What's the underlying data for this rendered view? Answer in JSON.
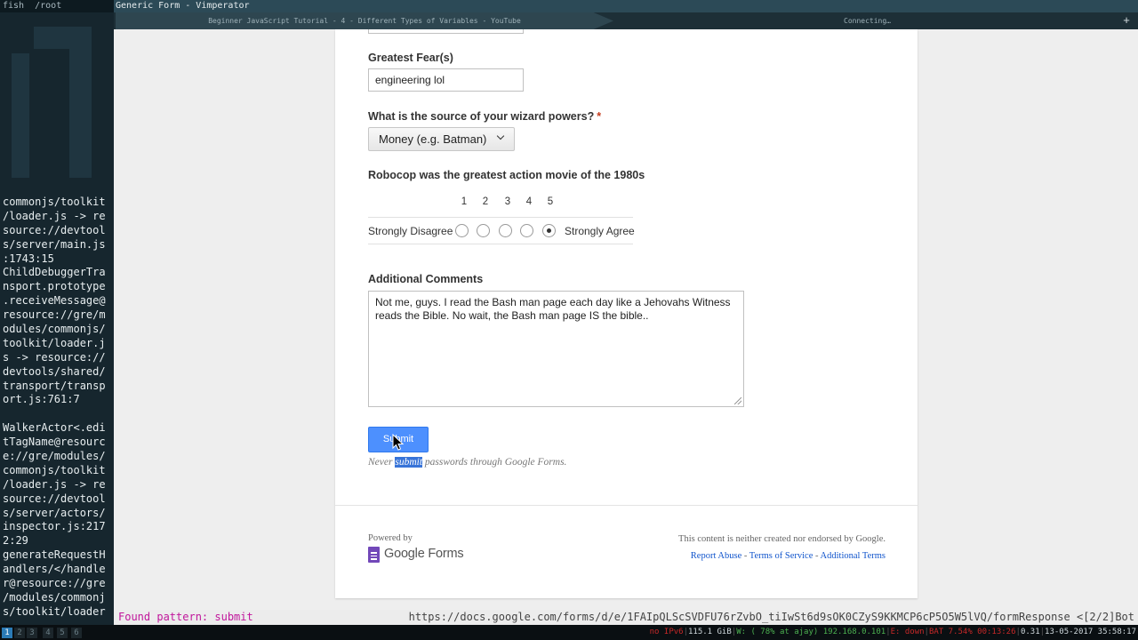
{
  "terminal": {
    "title": "fish  /root",
    "lines": [
      "commonjs/toolkit",
      "/loader.js -> re",
      "source://devtool",
      "s/server/main.js",
      ":1743:15",
      "ChildDebuggerTra",
      "nsport.prototype",
      ".receiveMessage@",
      "resource://gre/m",
      "odules/commonjs/",
      "toolkit/loader.j",
      "s -> resource://",
      "devtools/shared/",
      "transport/transp",
      "ort.js:761:7",
      "",
      "WalkerActor<.edi",
      "tTagName@resourc",
      "e://gre/modules/",
      "commonjs/toolkit",
      "/loader.js -> re",
      "source://devtool",
      "s/server/actors/",
      "inspector.js:217",
      "2:29",
      "generateRequestH",
      "andlers/</handle",
      "r@resource://gre",
      "/modules/commonj",
      "s/toolkit/loader"
    ]
  },
  "browser": {
    "window_title": "Generic Form - Vimperator",
    "tabs": [
      {
        "label": "Beginner JavaScript Tutorial - 4 - Different Types of Variables - YouTube"
      },
      {
        "label": "Connecting…"
      }
    ],
    "new_tab": "+"
  },
  "form": {
    "fear_label": "Greatest Fear(s)",
    "fear_value": "engineering lol",
    "wizard_label": "What is the source of your wizard powers?",
    "required_mark": "*",
    "wizard_selected": "Money (e.g. Batman)",
    "scale_label": "Robocop was the greatest action movie of the 1980s",
    "scale_numbers": [
      "1",
      "2",
      "3",
      "4",
      "5"
    ],
    "scale_low": "Strongly Disagree",
    "scale_high": "Strongly Agree",
    "scale_selected": 5,
    "comments_label": "Additional Comments",
    "comments_value": "Not me, guys. I read the Bash man page each day like a Jehovahs Witness reads the Bible. No wait, the Bash man page IS the bible..",
    "submit_label": "Submit",
    "note_prefix": "Never ",
    "note_highlight": "submit",
    "note_suffix": " passwords through Google Forms."
  },
  "footer": {
    "powered_by": "Powered by",
    "brand": "Google Forms",
    "disclaimer": "This content is neither created nor endorsed by Google.",
    "links": [
      "Report Abuse",
      "Terms of Service",
      "Additional Terms"
    ],
    "link_sep": " - "
  },
  "statusbar": {
    "left": "Found pattern: submit",
    "url": "https://docs.google.com/forms/d/e/1FAIpQLScSVDFU76rZvbO_tiIwSt6d9sOK0CZyS9KKMCP6cP5O5W5lVQ/formResponse",
    "right_suffix": " <[2/2]Bot"
  },
  "panel": {
    "workspaces": [
      "1",
      "2",
      "3",
      "4",
      "5",
      "6"
    ],
    "active_workspace": "1",
    "stats": {
      "vpn": "no IPv6",
      "mem": "115.1 GiB",
      "wifi": "W: ( 78% at ajay) 192.168.0.101",
      "eth": "E: down",
      "bat": "BAT 7.54% 00:13:26",
      "load": "0.31",
      "datetime": "13-05-2017 35:58:17"
    }
  },
  "colors": {
    "accent": "#4d90fe",
    "terminal_bg": "#16262e",
    "title_bar": "#2c4a57",
    "status_match": "#c0169b",
    "forms_purple": "#7248b9"
  }
}
